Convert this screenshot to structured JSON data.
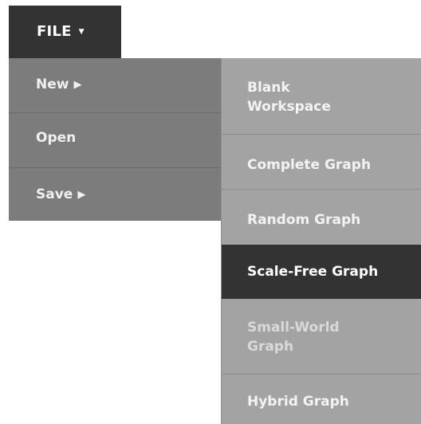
{
  "file_button": {
    "label": "FILE",
    "caret": "▼"
  },
  "file_menu": {
    "items": [
      {
        "label": "New",
        "arrow": "▶"
      },
      {
        "label": "Open"
      },
      {
        "label": "Save",
        "arrow": "▶"
      }
    ]
  },
  "new_submenu": {
    "items": [
      {
        "label": "Blank Workspace"
      },
      {
        "label": "Complete Graph"
      },
      {
        "label": "Random Graph"
      },
      {
        "label": "Scale-Free Graph"
      },
      {
        "label": "Small-World Graph"
      },
      {
        "label": "Hybrid Graph"
      }
    ],
    "active_item": "Scale-Free Graph"
  },
  "colors": {
    "file_button_bg": "#333333",
    "file_menu_bg": "#7c7c7c",
    "submenu_bg": "#a3a3a3",
    "active_bg": "#333333"
  }
}
